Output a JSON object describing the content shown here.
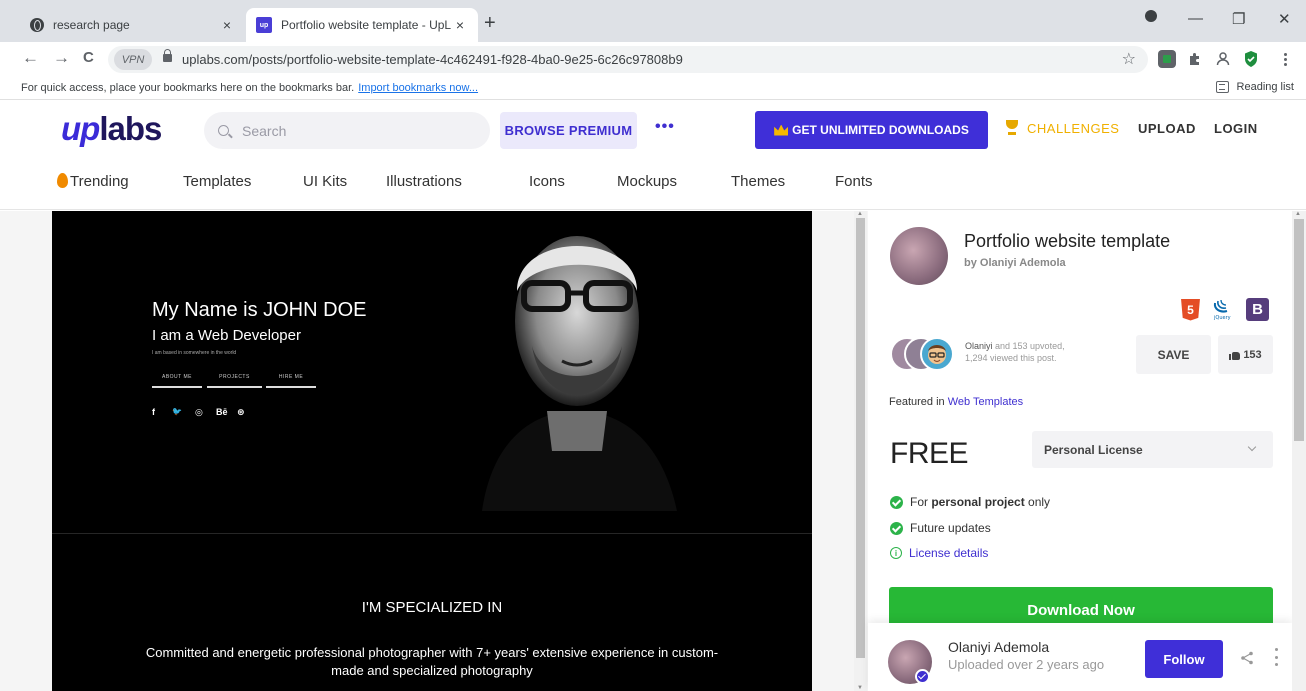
{
  "browser": {
    "tabs": [
      {
        "title": "research page",
        "icon": "globe-icon"
      },
      {
        "title": "Portfolio website template - UpL",
        "icon": "uplabs-favicon",
        "favicon_text": "up"
      }
    ],
    "close_glyph": "×",
    "new_tab_glyph": "+",
    "window_controls": {
      "minimize": "—",
      "restore": "❐",
      "close": "✕"
    },
    "nav": {
      "back": "←",
      "forward": "→",
      "reload": "C"
    },
    "vpn_label": "VPN",
    "url": "uplabs.com/posts/portfolio-website-template-4c462491-f928-4ba0-9e25-6c26c97808b9",
    "star_glyph": "☆",
    "bookmarks_text": "For quick access, place your bookmarks here on the bookmarks bar.",
    "bookmarks_link": "Import bookmarks now...",
    "reading_list": "Reading list"
  },
  "header": {
    "logo_up": "up",
    "logo_labs": "labs",
    "search_placeholder": "Search",
    "browse_premium": "BROWSE PREMIUM",
    "more": "•••",
    "get_unlimited": "GET UNLIMITED DOWNLOADS",
    "challenges": "CHALLENGES",
    "upload": "UPLOAD",
    "login": "LOGIN",
    "categories": [
      "Trending",
      "Templates",
      "UI Kits",
      "Illustrations",
      "Icons",
      "Mockups",
      "Themes",
      "Fonts"
    ]
  },
  "preview": {
    "name": "My Name is JOHN DOE",
    "role": "I am a Web Developer",
    "based": "I am based in somewhere in the world",
    "buttons": [
      "ABOUT ME",
      "PROJECTS",
      "HIRE ME"
    ],
    "social": [
      "f",
      "🐦",
      "◎",
      "Bē",
      "⊛"
    ],
    "specialized_title": "I'M SPECIALIZED IN",
    "specialized_text": "Committed and energetic professional photographer with 7+ years' extensive experience in custom-made and specialized photography"
  },
  "sidebar": {
    "title": "Portfolio website template",
    "author_line": "by Olaniyi Ademola",
    "tech_badges": {
      "html5": "5",
      "jquery": "jQuery",
      "bootstrap": "B"
    },
    "upvote_name": "Olaniyi",
    "upvote_rest": " and 153 upvoted,",
    "views_line": "1,294 viewed this post.",
    "save": "SAVE",
    "likes": "153",
    "featured_prefix": "Featured in ",
    "featured_link": "Web Templates",
    "price": "FREE",
    "license_selected": "Personal License",
    "feature_1_prefix": "For ",
    "feature_1_bold": "personal project",
    "feature_1_suffix": " only",
    "feature_2": "Future updates",
    "feature_3": "License details",
    "info_glyph": "i",
    "download": "Download Now",
    "footer_name": "Olaniyi Ademola",
    "footer_uploaded": "Uploaded over 2 years ago",
    "follow": "Follow"
  },
  "colors": {
    "brand": "#3f2fd8",
    "download_green": "#27b836",
    "challenge_gold": "#f0b000"
  }
}
